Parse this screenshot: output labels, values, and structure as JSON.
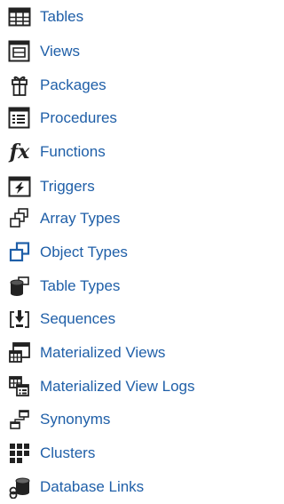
{
  "nodes": [
    {
      "label": "Tables",
      "icon": "table-icon"
    },
    {
      "label": "Views",
      "icon": "view-icon"
    },
    {
      "label": "Packages",
      "icon": "package-icon"
    },
    {
      "label": "Procedures",
      "icon": "procedure-icon"
    },
    {
      "label": "Functions",
      "icon": "function-icon"
    },
    {
      "label": "Triggers",
      "icon": "trigger-icon"
    },
    {
      "label": "Array Types",
      "icon": "array-type-icon"
    },
    {
      "label": "Object Types",
      "icon": "object-type-icon"
    },
    {
      "label": "Table Types",
      "icon": "table-type-icon"
    },
    {
      "label": "Sequences",
      "icon": "sequence-icon"
    },
    {
      "label": "Materialized Views",
      "icon": "materialized-view-icon"
    },
    {
      "label": "Materialized View Logs",
      "icon": "materialized-view-log-icon"
    },
    {
      "label": "Synonyms",
      "icon": "synonym-icon"
    },
    {
      "label": "Clusters",
      "icon": "cluster-icon"
    },
    {
      "label": "Database Links",
      "icon": "database-link-icon"
    }
  ],
  "function_glyph": "fx",
  "colors": {
    "label": "#1f5fa8",
    "icon_dark": "#222222",
    "accent_blue": "#1f5fa8"
  }
}
